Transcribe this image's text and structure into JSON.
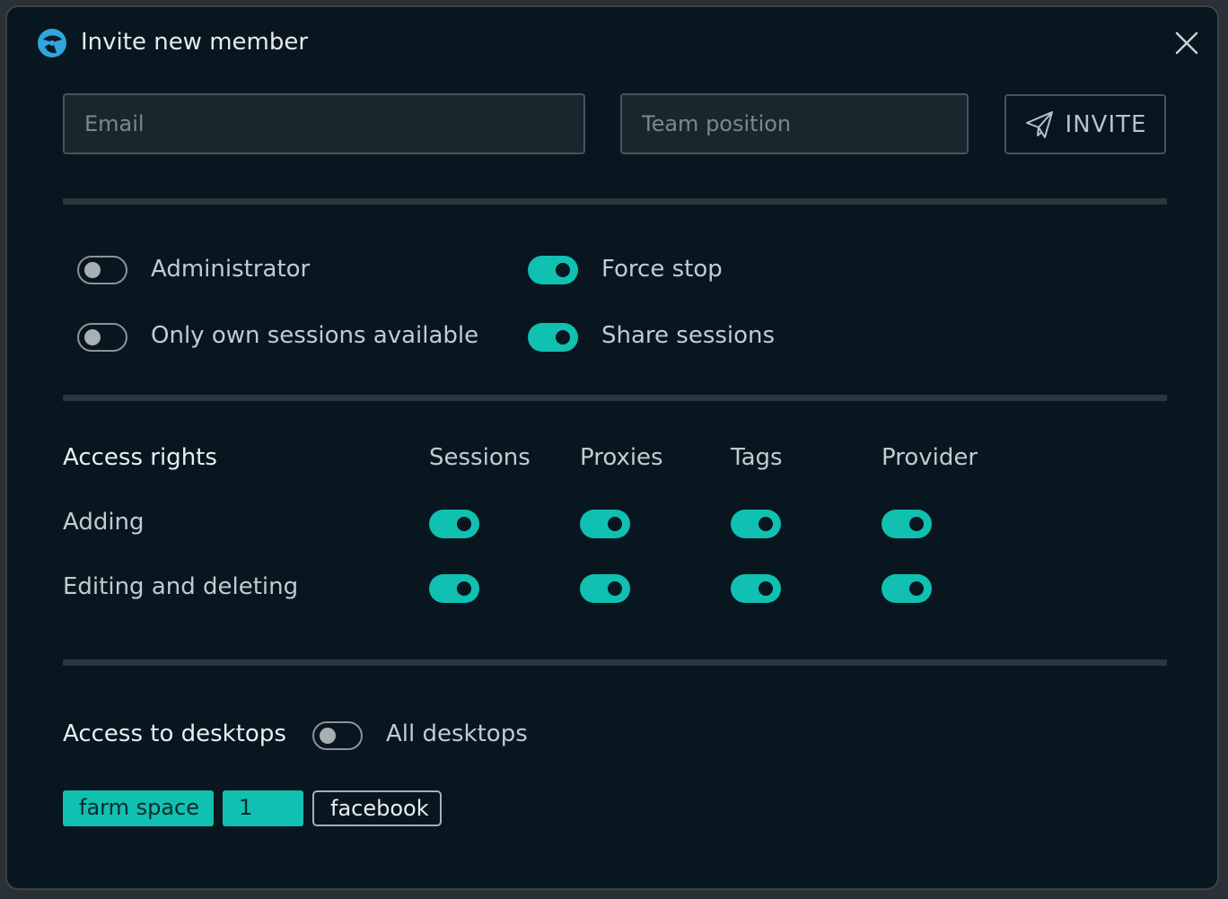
{
  "header": {
    "title": "Invite new member",
    "logo_icon": "brand-logo-icon",
    "close_icon": "close-icon"
  },
  "form": {
    "email_placeholder": "Email",
    "email_value": "",
    "position_placeholder": "Team position",
    "position_value": "",
    "invite_label": "INVITE",
    "invite_icon": "paper-plane-icon"
  },
  "permissions": {
    "administrator": {
      "label": "Administrator",
      "on": false
    },
    "own_sessions": {
      "label": "Only own sessions available",
      "on": false
    },
    "force_stop": {
      "label": "Force stop",
      "on": true
    },
    "share_sessions": {
      "label": "Share sessions",
      "on": true
    }
  },
  "access_rights": {
    "title": "Access rights",
    "columns": [
      "Sessions",
      "Proxies",
      "Tags",
      "Provider"
    ],
    "rows": [
      {
        "label": "Adding",
        "values": [
          true,
          true,
          true,
          true
        ]
      },
      {
        "label": "Editing and deleting",
        "values": [
          true,
          true,
          true,
          true
        ]
      }
    ]
  },
  "desktops": {
    "title": "Access to desktops",
    "all_desktops": {
      "label": "All desktops",
      "on": false
    },
    "chips": [
      {
        "label": "farm space",
        "selected": true
      },
      {
        "label": "1",
        "selected": true
      },
      {
        "label": "facebook",
        "selected": false
      }
    ]
  },
  "colors": {
    "accent": "#10c0b1",
    "background": "#08161f",
    "border": "#49535a"
  }
}
